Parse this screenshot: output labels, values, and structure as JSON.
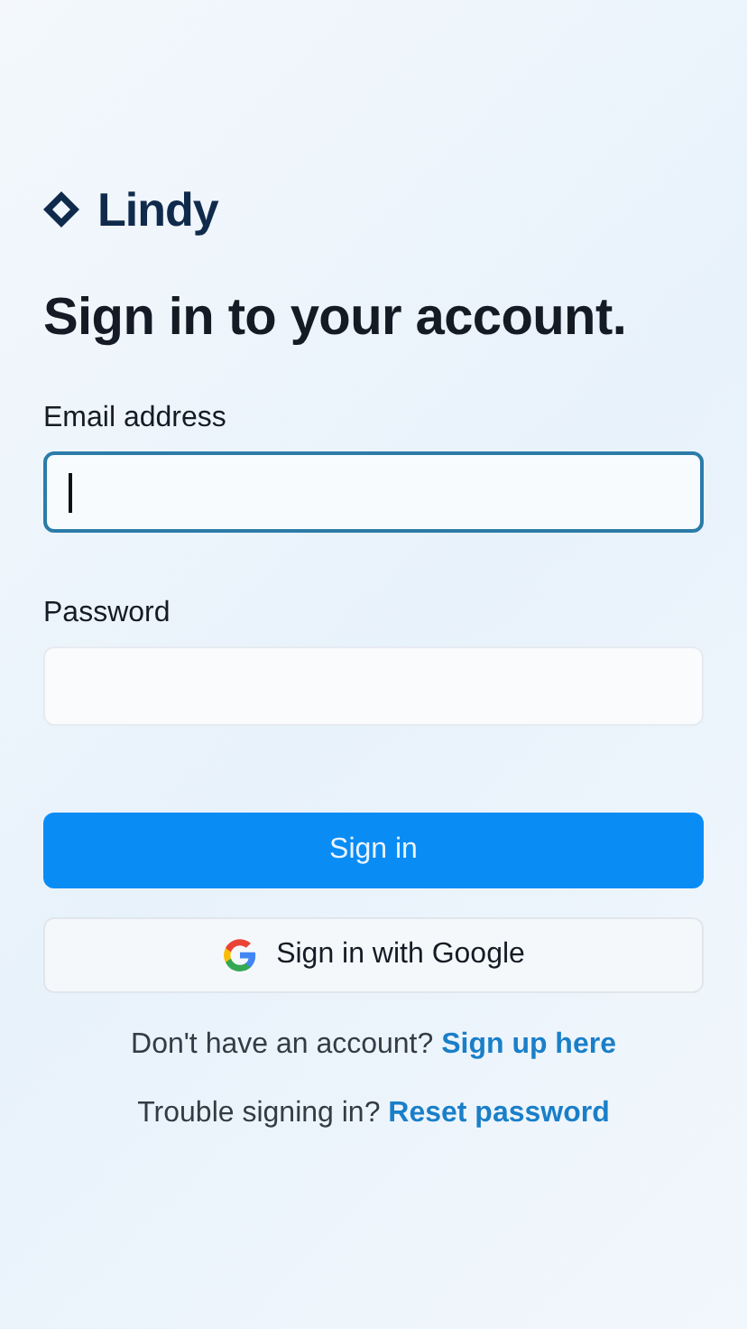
{
  "logo": {
    "text": "Lindy"
  },
  "heading": "Sign in to your account.",
  "fields": [
    {
      "label": "Email address",
      "focused": true
    },
    {
      "label": "Password",
      "focused": false
    }
  ],
  "buttons": [
    {
      "kind": "primary",
      "label": "Sign in"
    },
    {
      "kind": "google",
      "label": "Sign in with Google"
    }
  ],
  "prompts": [
    {
      "text": "Don't have an account?",
      "link": "Sign up here"
    },
    {
      "text": "Trouble signing in?",
      "link": "Reset password"
    }
  ]
}
